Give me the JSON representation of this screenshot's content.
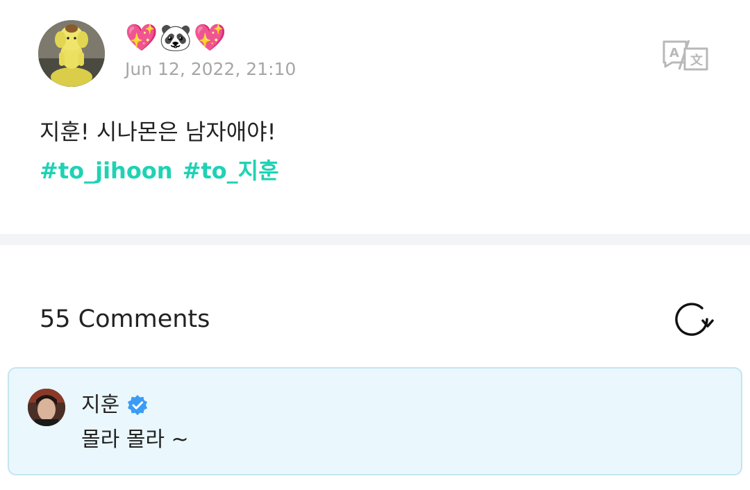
{
  "post": {
    "author_emoji": "💖🐼💖",
    "date": "Jun 12, 2022, 21:10",
    "text": "지훈! 시나몬은 남자애야!",
    "hashtags": [
      "#to_jihoon",
      "#to_지훈"
    ],
    "hashtag_color": "#1fd2b4"
  },
  "comments": {
    "header": "55 Comments",
    "items": [
      {
        "author": "지훈",
        "verified": true,
        "text": "몰라 몰라 ~"
      }
    ]
  },
  "icons": {
    "translate": "translate-icon",
    "refresh": "refresh-icon",
    "verified": "verified-badge-icon"
  },
  "colors": {
    "accent": "#1fd2b4",
    "verified": "#3b9cf5",
    "comment_bg": "#eaf7fd",
    "comment_border": "#c3e5ef",
    "meta_text": "#a6a6a6"
  }
}
